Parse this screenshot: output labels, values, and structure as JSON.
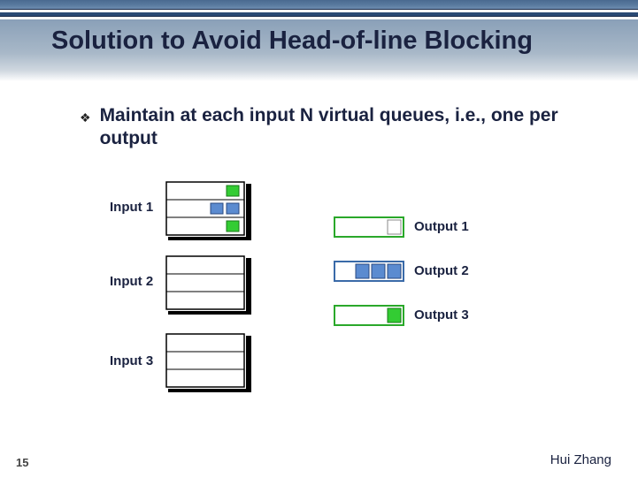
{
  "title": "Solution to Avoid Head-of-line Blocking",
  "bullet": {
    "glyph": "❖",
    "text": "Maintain at each input N virtual queues, i.e., one per output"
  },
  "labels": {
    "input1": "Input 1",
    "input2": "Input 2",
    "input3": "Input 3",
    "output1": "Output 1",
    "output2": "Output 2",
    "output3": "Output 3"
  },
  "colors": {
    "green": "#33cc33",
    "blue": "#5b8bd0",
    "white": "#ffffff",
    "outline_green": "#2aa82a",
    "outline_blue": "#3a6aa8"
  },
  "slide_number": "15",
  "author": "Hui Zhang"
}
